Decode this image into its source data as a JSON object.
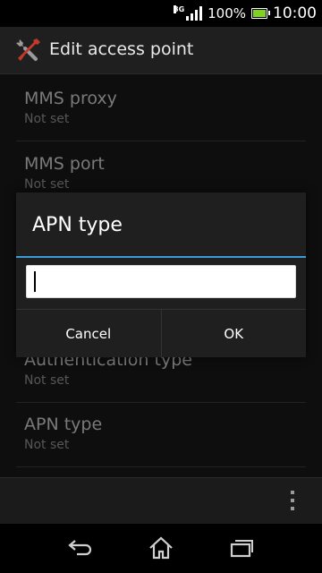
{
  "status_bar": {
    "network_type": "3G",
    "battery_percent": "100%",
    "time": "10:00"
  },
  "action_bar": {
    "icon": "tools-icon",
    "title": "Edit access point"
  },
  "settings": [
    {
      "title": "MMS proxy",
      "summary": "Not set"
    },
    {
      "title": "MMS port",
      "summary": "Not set"
    },
    {
      "title": "Authentication type",
      "summary": "Not set"
    },
    {
      "title": "APN type",
      "summary": "Not set"
    }
  ],
  "dialog": {
    "title": "APN type",
    "input_value": "",
    "cancel_label": "Cancel",
    "ok_label": "OK"
  },
  "nav_bar": {
    "icons": [
      "back-icon",
      "home-icon",
      "recent-apps-icon"
    ]
  },
  "colors": {
    "accent": "#3c9ad6",
    "battery": "#7ed321"
  }
}
